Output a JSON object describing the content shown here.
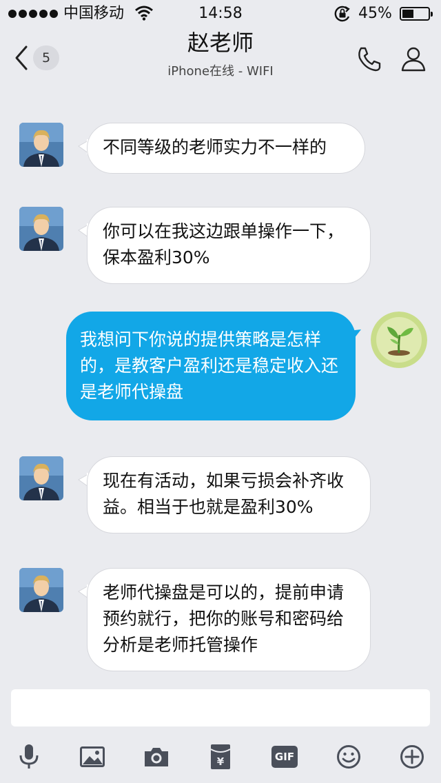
{
  "status_bar": {
    "carrier": "中国移动",
    "time": "14:58",
    "battery_percent": "45%",
    "battery_level": 0.45,
    "icons": [
      "signal-dots",
      "wifi-icon",
      "rotation-lock-icon",
      "battery-icon"
    ]
  },
  "nav": {
    "back_icon": "chevron-left-icon",
    "unread_count": "5",
    "title": "赵老师",
    "subtitle": "iPhone在线 - WIFI",
    "call_icon": "phone-icon",
    "profile_icon": "person-icon"
  },
  "messages": [
    {
      "direction": "incoming",
      "avatar": "teacher-avatar",
      "text": "不同等级的老师实力不一样的"
    },
    {
      "direction": "incoming",
      "avatar": "teacher-avatar",
      "text": "你可以在我这边跟单操作一下，保本盈利30%"
    },
    {
      "direction": "outgoing",
      "avatar": "plant-avatar",
      "text": "我想问下你说的提供策略是怎样的，是教客户盈利还是稳定收入还是老师代操盘"
    },
    {
      "direction": "incoming",
      "avatar": "teacher-avatar",
      "text": "现在有活动，如果亏损会补齐收益。相当于也就是盈利30%"
    },
    {
      "direction": "incoming",
      "avatar": "teacher-avatar",
      "text": "老师代操盘是可以的，提前申请预约就行，把你的账号和密码给分析是老师托管操作"
    }
  ],
  "input": {
    "placeholder": ""
  },
  "toolbar": {
    "items": [
      {
        "name": "voice",
        "icon": "microphone-icon"
      },
      {
        "name": "image",
        "icon": "image-icon"
      },
      {
        "name": "camera",
        "icon": "camera-icon"
      },
      {
        "name": "red-packet",
        "icon": "red-packet-icon",
        "symbol": "¥"
      },
      {
        "name": "gif",
        "icon": "gif-icon",
        "label": "GIF"
      },
      {
        "name": "emoji",
        "icon": "emoji-icon"
      },
      {
        "name": "more",
        "icon": "plus-icon"
      }
    ]
  }
}
